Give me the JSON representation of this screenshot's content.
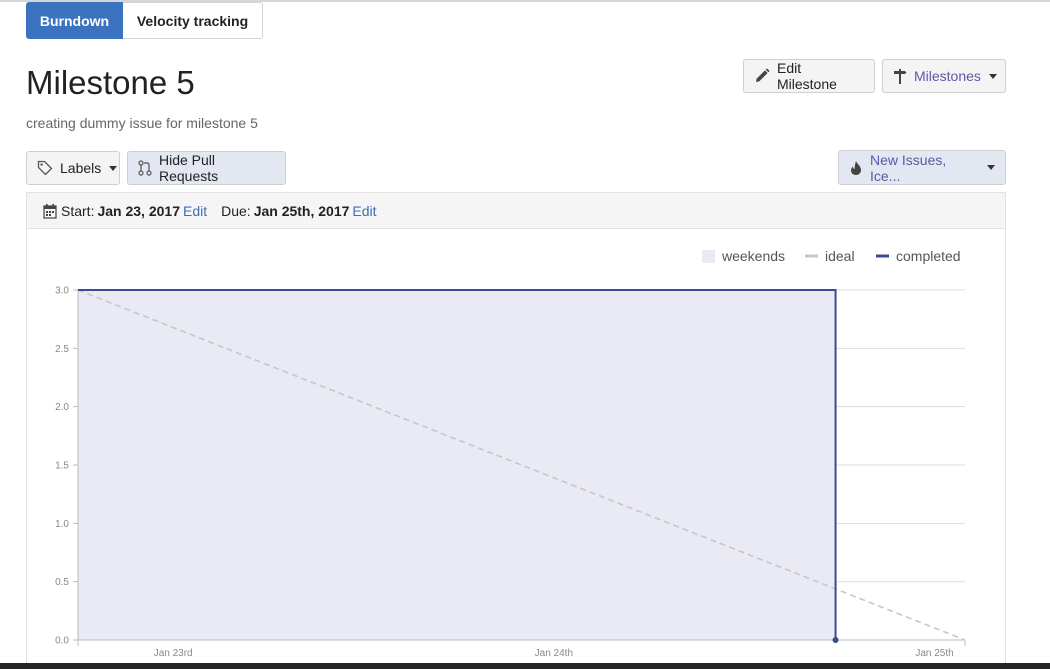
{
  "tabs": [
    {
      "label": "Burndown",
      "active": true
    },
    {
      "label": "Velocity tracking",
      "active": false
    }
  ],
  "milestone": {
    "title": "Milestone 5",
    "description": "creating dummy issue for milestone 5"
  },
  "toolbar": {
    "edit_label": "Edit Milestone",
    "milestones_label": "Milestones",
    "labels_label": "Labels",
    "hide_pr_label": "Hide Pull Requests",
    "filter_label": "New Issues, Ice..."
  },
  "dates": {
    "start_prefix": "Start:",
    "start_value": "Jan 23, 2017",
    "start_edit": "Edit",
    "due_prefix": "Due:",
    "due_value": "Jan 25th, 2017",
    "due_edit": "Edit"
  },
  "colors": {
    "accent": "#3b73c0",
    "link": "#3d6fb4",
    "completed": "#3b4a95",
    "ideal": "#c7c7c7",
    "weekend_fill": "#e9eaf4"
  },
  "chart_data": {
    "type": "line",
    "ylim": [
      0,
      3
    ],
    "yticks": [
      "0.0",
      "0.5",
      "1.0",
      "1.5",
      "2.0",
      "2.5",
      "3.0"
    ],
    "xticks": [
      "Jan 23rd",
      "Jan 24th",
      "Jan 25th"
    ],
    "x_range_days": [
      -0.25,
      2.08
    ],
    "legend": [
      {
        "name": "weekends",
        "kind": "box"
      },
      {
        "name": "ideal",
        "kind": "line"
      },
      {
        "name": "completed",
        "kind": "line"
      }
    ],
    "legend_position": "top-right",
    "grid": true,
    "series": [
      {
        "name": "ideal",
        "style": "dashed",
        "points": [
          [
            -0.25,
            3
          ],
          [
            2.08,
            0
          ]
        ]
      },
      {
        "name": "completed",
        "style": "solid",
        "fill": true,
        "points": [
          [
            -0.25,
            3
          ],
          [
            1.74,
            3
          ],
          [
            1.74,
            0
          ]
        ]
      }
    ]
  }
}
